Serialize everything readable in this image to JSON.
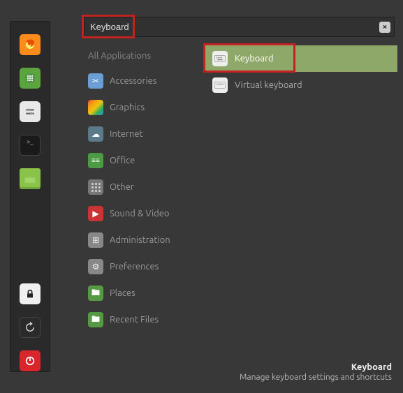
{
  "search": {
    "value": "Keyboard"
  },
  "categories": {
    "header": "All Applications",
    "items": [
      {
        "label": "Accessories"
      },
      {
        "label": "Graphics"
      },
      {
        "label": "Internet"
      },
      {
        "label": "Office"
      },
      {
        "label": "Other"
      },
      {
        "label": "Sound & Video"
      },
      {
        "label": "Administration"
      },
      {
        "label": "Preferences"
      },
      {
        "label": "Places"
      },
      {
        "label": "Recent Files"
      }
    ]
  },
  "results": [
    {
      "label": "Keyboard",
      "selected": true
    },
    {
      "label": "Virtual keyboard",
      "selected": false
    }
  ],
  "footer": {
    "title": "Keyboard",
    "description": "Manage keyboard settings and shortcuts"
  }
}
